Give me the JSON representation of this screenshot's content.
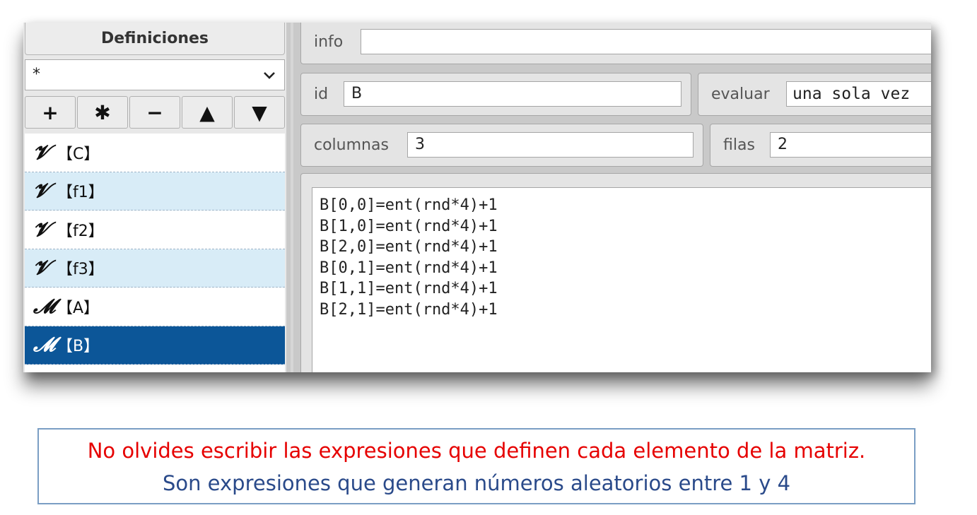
{
  "left_panel": {
    "header": "Definiciones",
    "selector": {
      "value": "*",
      "icon": "chevron-down-icon"
    },
    "buttons": [
      {
        "label": "+",
        "name": "add"
      },
      {
        "label": "✱",
        "name": "duplicate"
      },
      {
        "label": "−",
        "name": "remove"
      },
      {
        "label": "▲",
        "name": "move-up"
      },
      {
        "label": "▼",
        "name": "move-down"
      }
    ],
    "items": [
      {
        "symbol": "𝓥",
        "label": "【C】",
        "state": "normal"
      },
      {
        "symbol": "𝓥",
        "label": "【f1】",
        "state": "alt"
      },
      {
        "symbol": "𝓥",
        "label": "【f2】",
        "state": "normal"
      },
      {
        "symbol": "𝓥",
        "label": "【f3】",
        "state": "alt"
      },
      {
        "symbol": "𝓜",
        "label": "【A】",
        "state": "normal"
      },
      {
        "symbol": "𝓜",
        "label": "【B】",
        "state": "selected"
      }
    ]
  },
  "right_panel": {
    "info": {
      "label": "info",
      "value": ""
    },
    "id": {
      "label": "id",
      "value": "B"
    },
    "evaluar": {
      "label": "evaluar",
      "value": "una sola vez"
    },
    "columnas": {
      "label": "columnas",
      "value": "3"
    },
    "filas": {
      "label": "filas",
      "value": "2"
    },
    "expressions": [
      "B[0,0]=ent(rnd*4)+1",
      "B[1,0]=ent(rnd*4)+1",
      "B[2,0]=ent(rnd*4)+1",
      "B[0,1]=ent(rnd*4)+1",
      "B[1,1]=ent(rnd*4)+1",
      "B[2,1]=ent(rnd*4)+1"
    ]
  },
  "note": {
    "line1": "No olvides escribir las expresiones que definen cada elemento de la matriz.",
    "line2": "Son expresiones que generan números aleatorios entre 1 y 4",
    "colors": {
      "line1": "#e60000",
      "line2": "#2a4a8a",
      "border": "#7a9ec4"
    }
  },
  "colors": {
    "selected_item": "#0c5698",
    "alt_item": "#d8ecf7"
  }
}
